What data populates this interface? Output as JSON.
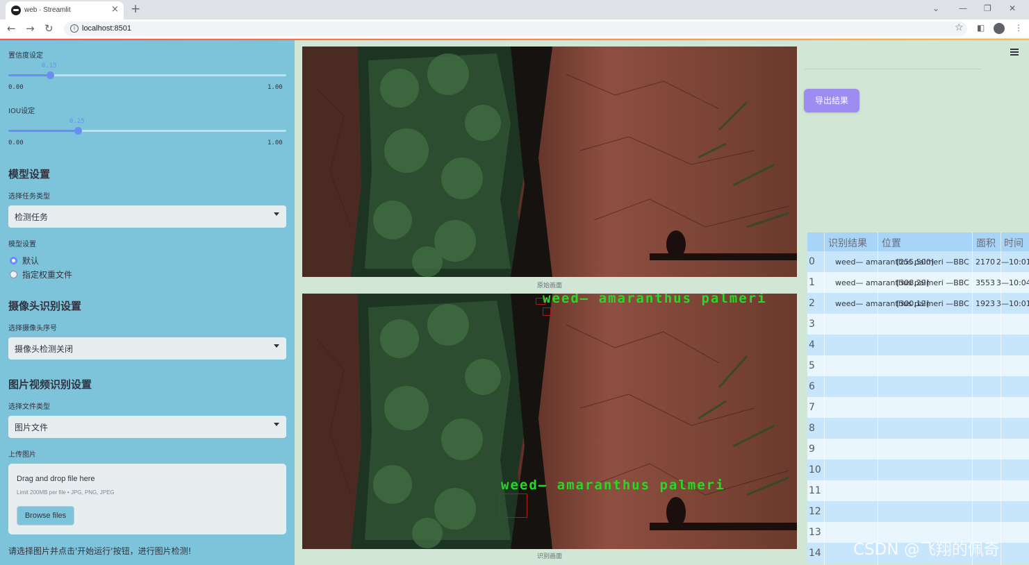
{
  "browser": {
    "tab_title": "web · Streamlit",
    "url": "localhost:8501"
  },
  "sidebar": {
    "conf_label": "置信度设定",
    "conf_value": "0.15",
    "conf_min": "0.00",
    "conf_max": "1.00",
    "conf_fraction": 0.15,
    "iou_label": "IOU设定",
    "iou_value": "0.25",
    "iou_min": "0.00",
    "iou_max": "1.00",
    "iou_fraction": 0.25,
    "model_heading": "模型设置",
    "task_label": "选择任务类型",
    "task_value": "检测任务",
    "model_label": "模型设置",
    "model_options": [
      "默认",
      "指定权重文件"
    ],
    "model_selected": "默认",
    "camera_heading": "摄像头识别设置",
    "camera_label": "选择摄像头序号",
    "camera_value": "摄像头检测关闭",
    "media_heading": "图片视频识别设置",
    "file_type_label": "选择文件类型",
    "file_type_value": "图片文件",
    "upload_label": "上传图片",
    "upload_title": "Drag and drop file here",
    "upload_limit": "Limit 200MB per file • JPG, PNG, JPEG",
    "browse_label": "Browse files",
    "hint": "请选择图片并点击'开始运行'按钮，进行图片检测!"
  },
  "main": {
    "original_caption": "原始画面",
    "result_caption": "识别画面",
    "export_label": "导出结果",
    "detections": [
      {
        "label": "weed— amaranthus palmeri"
      },
      {
        "label": "weed— amaranthus palmeri"
      }
    ]
  },
  "table": {
    "headers": [
      "识别结果",
      "位置",
      "面积",
      "时间"
    ],
    "rows": [
      {
        "index": "0",
        "result": "weed— amaranthus palmeri —BBC",
        "position": "[255,500]",
        "area": "2170",
        "time": "2—10:01"
      },
      {
        "index": "1",
        "result": "weed— amaranthus palmeri —BBC",
        "position": "[308,29]",
        "area": "3553",
        "time": "3—10:04"
      },
      {
        "index": "2",
        "result": "weed— amaranthus palmeri —BBC",
        "position": "[300,12]",
        "area": "1923",
        "time": "3—10:01"
      },
      {
        "index": "3"
      },
      {
        "index": "4"
      },
      {
        "index": "5"
      },
      {
        "index": "6"
      },
      {
        "index": "7"
      },
      {
        "index": "8"
      },
      {
        "index": "9"
      },
      {
        "index": "10"
      },
      {
        "index": "11"
      },
      {
        "index": "12"
      },
      {
        "index": "13"
      },
      {
        "index": "14"
      }
    ]
  },
  "watermark": "CSDN @飞翔的佩奇",
  "colors": {
    "sidebar_bg": "#7dc3da",
    "main_bg": "#d2e6d6",
    "accent": "#6c8cf5",
    "export_button": "#9d8df1",
    "detection_text": "#26d926",
    "detection_box": "#b01818"
  }
}
